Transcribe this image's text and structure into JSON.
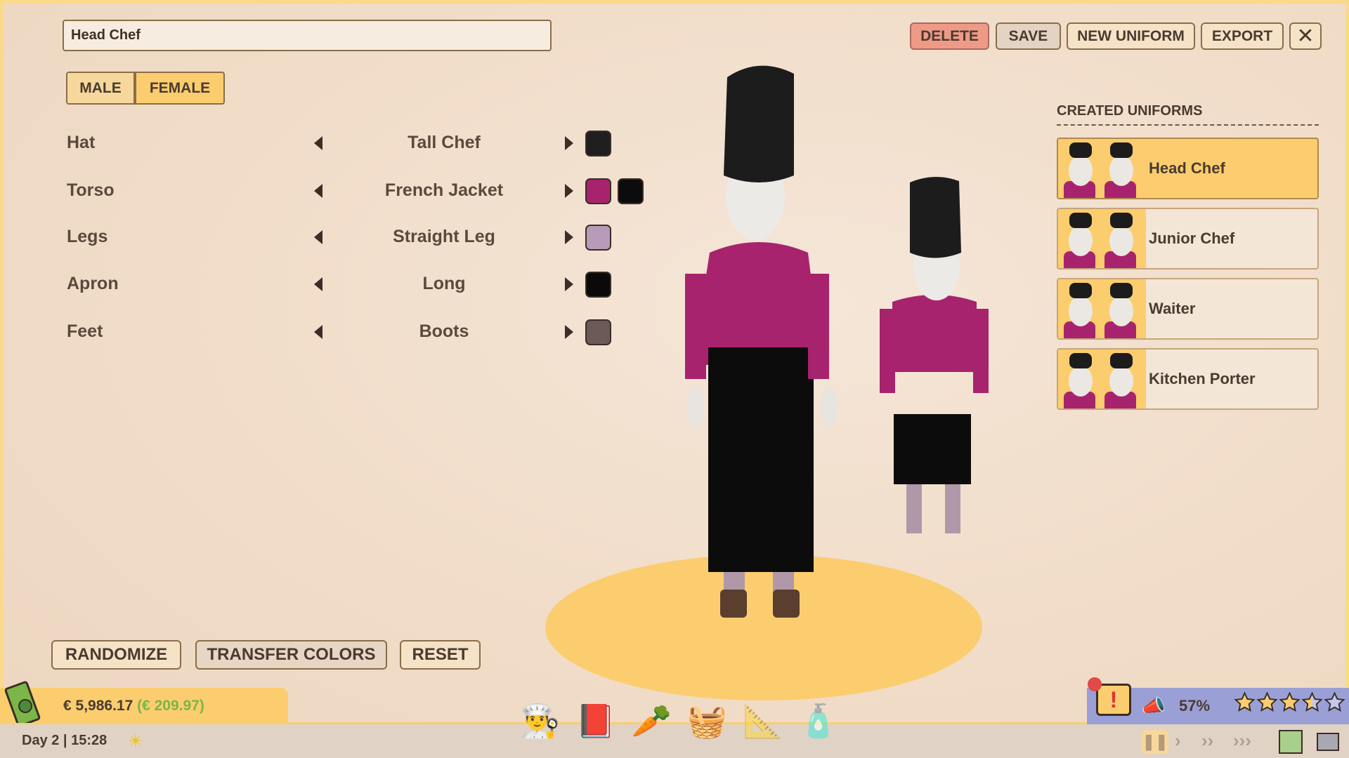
{
  "editor": {
    "uniform_name": "Head Chef",
    "gender_options": [
      "MALE",
      "FEMALE"
    ],
    "selected_gender": "FEMALE"
  },
  "toolbar": {
    "delete": "DELETE",
    "save": "SAVE",
    "new_uniform": "NEW UNIFORM",
    "export": "EXPORT",
    "close_icon": "close-icon"
  },
  "parts": [
    {
      "label": "Hat",
      "value": "Tall Chef",
      "colors": [
        "#1f1f1f"
      ]
    },
    {
      "label": "Torso",
      "value": "French Jacket",
      "colors": [
        "#a8236e",
        "#0c0c0c"
      ]
    },
    {
      "label": "Legs",
      "value": "Straight Leg",
      "colors": [
        "#b79bb8"
      ]
    },
    {
      "label": "Apron",
      "value": "Long",
      "colors": [
        "#0a0a0a"
      ]
    },
    {
      "label": "Feet",
      "value": "Boots",
      "colors": [
        "#6b5a58"
      ]
    }
  ],
  "uniforms": {
    "title": "CREATED UNIFORMS",
    "items": [
      "Head Chef",
      "Junior Chef",
      "Waiter",
      "Kitchen Porter"
    ],
    "selected": "Head Chef"
  },
  "actions": {
    "randomize": "RANDOMIZE",
    "transfer": "TRANSFER COLORS",
    "reset": "RESET"
  },
  "status": {
    "money": "€ 5,986.17",
    "delta": "(€ 209.97)",
    "day_time": "Day 2 | 15:28",
    "popularity": "57%",
    "rating": 3.5,
    "rating_max": 5
  },
  "colors": {
    "accent": "#fbcd6e",
    "delta_green": "#7ab648",
    "rating_panel": "#9aa0d6"
  }
}
